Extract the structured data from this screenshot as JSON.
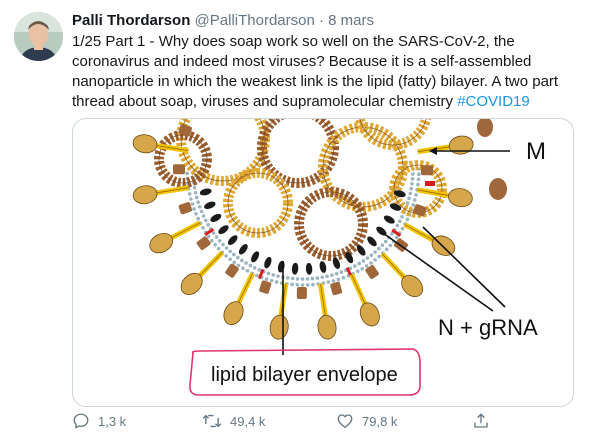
{
  "tweet": {
    "author_name": "Palli Thordarson",
    "handle": "@PalliThordarson",
    "separator": "·",
    "date": "8 mars",
    "text_main": "1/25 Part 1 - Why does soap work so well on the SARS-CoV-2, the coronavirus and indeed most viruses? Because it is a self-assembled nanoparticle in which the weakest link is the lipid (fatty) bilayer. A two part thread about soap, viruses and supramolecular chemistry",
    "hashtag": "#COVID19"
  },
  "figure": {
    "label_m": "M",
    "label_n": "N + gRNA",
    "label_envelope": "lipid bilayer envelope",
    "colors": {
      "spike_yellow": "#f2c200",
      "spike_head": "#d6a64b",
      "brown": "#a0683a",
      "ring": "#e0a832",
      "ring_dark": "#9a5c2c",
      "lipid": "#9bb4bf",
      "red": "#d91e1e",
      "highlight": "#e0356f"
    }
  },
  "actions": {
    "reply_count": "1,3 k",
    "retweet_count": "49,4 k",
    "like_count": "79,8 k"
  }
}
